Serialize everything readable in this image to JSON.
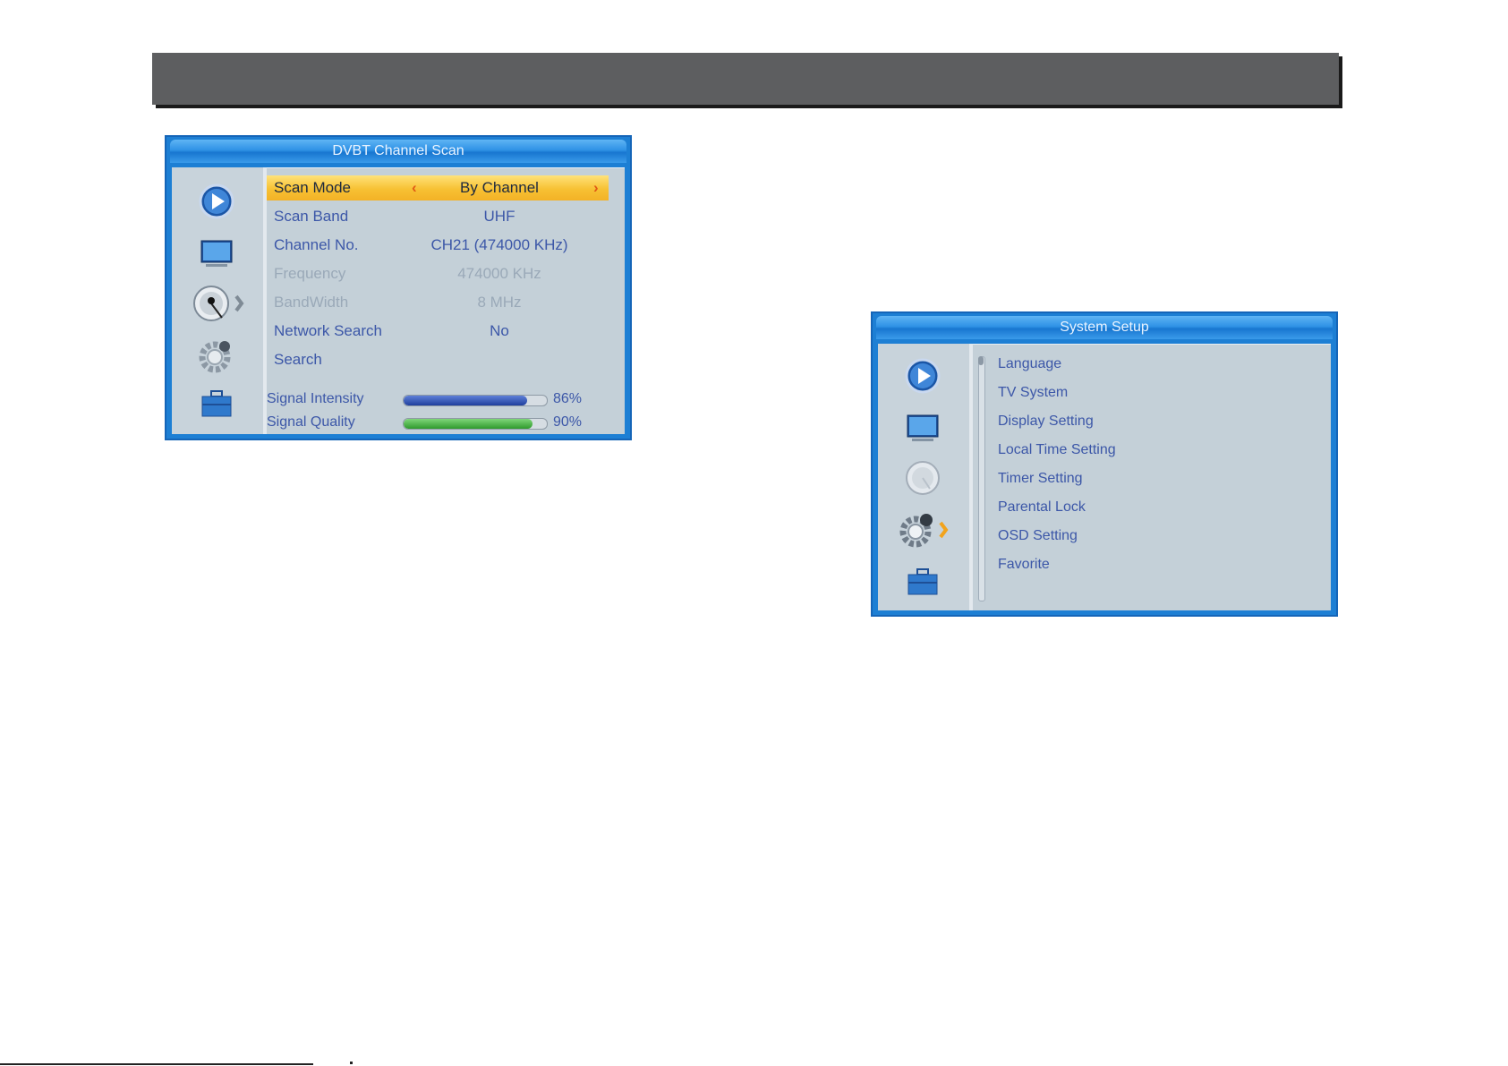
{
  "scan_window": {
    "title": "DVBT Channel Scan",
    "rows": [
      {
        "label": "Scan Mode",
        "value": "By Channel",
        "state": "selected"
      },
      {
        "label": "Scan Band",
        "value": "UHF",
        "state": "normal"
      },
      {
        "label": "Channel No.",
        "value": "CH21 (474000 KHz)",
        "state": "normal"
      },
      {
        "label": "Frequency",
        "value": "474000 KHz",
        "state": "disabled"
      },
      {
        "label": "BandWidth",
        "value": "8 MHz",
        "state": "disabled"
      },
      {
        "label": "Network Search",
        "value": "No",
        "state": "normal"
      },
      {
        "label": "Search",
        "value": "",
        "state": "normal"
      }
    ],
    "signal_intensity": {
      "label": "Signal Intensity",
      "percent_text": "86%",
      "level": 0.86
    },
    "signal_quality": {
      "label": "Signal Quality",
      "percent_text": "90%",
      "level": 0.9
    },
    "sidebar_icons": [
      "play-icon",
      "tv-icon",
      "satellite-dish-icon",
      "gear-icon",
      "toolbox-icon"
    ],
    "active_icon": "satellite-dish-icon"
  },
  "system_window": {
    "title": "System Setup",
    "items": [
      "Language",
      "TV System",
      "Display Setting",
      "Local Time Setting",
      "Timer Setting",
      "Parental Lock",
      "OSD Setting",
      "Favorite"
    ],
    "sidebar_icons": [
      "play-icon",
      "tv-icon",
      "satellite-dish-icon",
      "gear-icon",
      "toolbox-icon"
    ],
    "active_icon": "gear-icon"
  },
  "colors": {
    "frame_blue": "#1d7fd4",
    "panel_bg": "#c4d0d8",
    "text_blue": "#3c57a8",
    "highlight_yellow": "#f7c133",
    "header_gray": "#5d5e60"
  }
}
